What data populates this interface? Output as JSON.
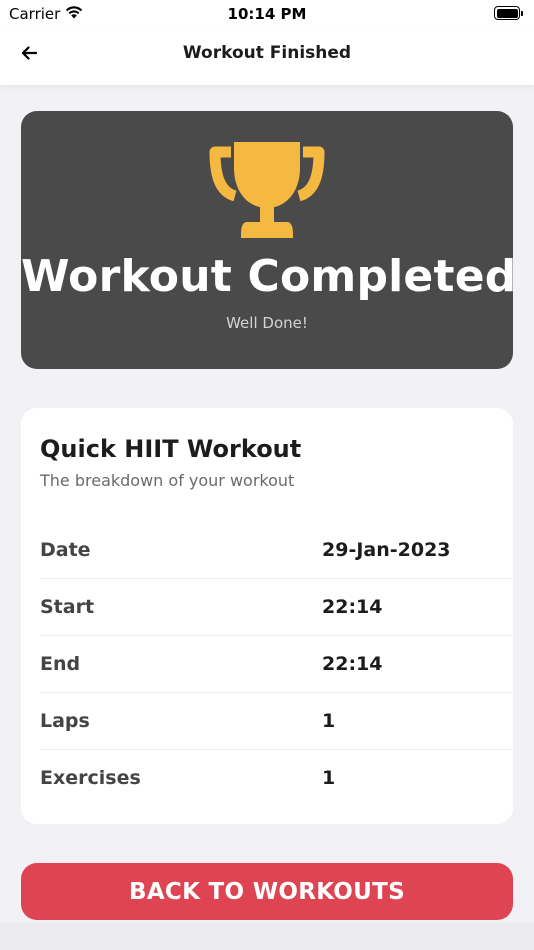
{
  "status_bar": {
    "carrier": "Carrier",
    "time": "10:14 PM"
  },
  "nav": {
    "title": "Workout Finished",
    "back_icon": "arrow-left-icon"
  },
  "hero": {
    "icon": "trophy-icon",
    "icon_color": "#F5B841",
    "title": "Workout Completed",
    "subtitle": "Well Done!",
    "background_color": "#4A4A4A"
  },
  "summary": {
    "title": "Quick HIIT Workout",
    "subtitle": "The breakdown of your workout",
    "rows": [
      {
        "label": "Date",
        "value": "29-Jan-2023"
      },
      {
        "label": "Start",
        "value": "22:14"
      },
      {
        "label": "End",
        "value": "22:14"
      },
      {
        "label": "Laps",
        "value": "1"
      },
      {
        "label": "Exercises",
        "value": "1"
      }
    ]
  },
  "actions": {
    "back_to_workouts_label": "BACK TO WORKOUTS",
    "button_color": "#DE4452"
  }
}
